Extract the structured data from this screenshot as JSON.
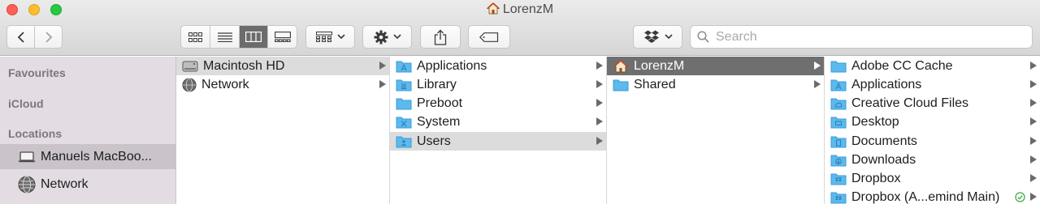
{
  "window": {
    "title": "LorenzM"
  },
  "toolbar": {
    "search_placeholder": "Search"
  },
  "sidebar": {
    "sections": [
      {
        "label": "Favourites"
      },
      {
        "label": "iCloud"
      },
      {
        "label": "Locations"
      }
    ],
    "items": [
      {
        "label": "Manuels MacBoo..."
      },
      {
        "label": "Network"
      }
    ]
  },
  "columns": [
    {
      "items": [
        {
          "label": "Macintosh HD"
        },
        {
          "label": "Network"
        }
      ]
    },
    {
      "items": [
        {
          "label": "Applications"
        },
        {
          "label": "Library"
        },
        {
          "label": "Preboot"
        },
        {
          "label": "System"
        },
        {
          "label": "Users"
        }
      ]
    },
    {
      "items": [
        {
          "label": "LorenzM"
        },
        {
          "label": "Shared"
        }
      ]
    },
    {
      "items": [
        {
          "label": "Adobe CC Cache"
        },
        {
          "label": "Applications"
        },
        {
          "label": "Creative Cloud Files"
        },
        {
          "label": "Desktop"
        },
        {
          "label": "Documents"
        },
        {
          "label": "Downloads"
        },
        {
          "label": "Dropbox"
        },
        {
          "label": "Dropbox (A...emind Main)"
        }
      ]
    }
  ],
  "colors": {
    "folder": "#5cb9ee",
    "selected_dark": "#6f6f6f",
    "selected_gray": "#dcdcdc",
    "sidebar_bg": "#e3dde3"
  }
}
